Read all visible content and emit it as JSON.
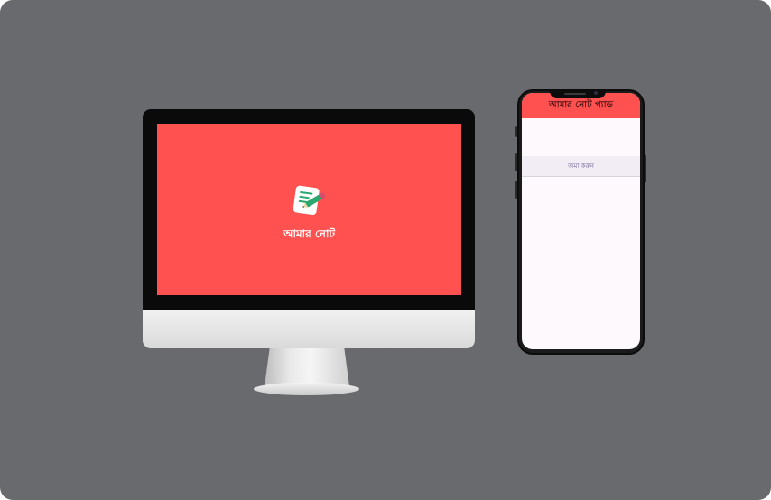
{
  "desktop": {
    "app_title": "আমার নোট",
    "logo_icon": "note-pencil-icon",
    "splash_color": "#fe5150"
  },
  "mobile": {
    "appbar_title": "আমার নোট প্যাড",
    "title_input_value": "",
    "body_input_value": "",
    "save_label": "জমা করুন",
    "appbar_color": "#fe5150"
  }
}
